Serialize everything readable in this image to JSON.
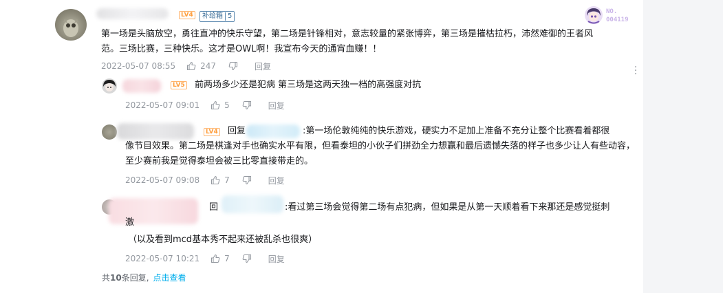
{
  "main_comment": {
    "level": "LV4",
    "fan_badge": {
      "name": "补给箱",
      "level": "5"
    },
    "text": "第一场是头脑放空，勇往直冲的快乐守望，第二场是针锋相对，意志较量的紧张博弈，第三场是摧枯拉朽，沛然难御的王者风范。三场比赛，三种快乐。这才是OWL啊！我宣布今天的通宵血赚！！",
    "time": "2022-05-07 08:55",
    "likes": "247",
    "reply_label": "回复",
    "badge_no_label": "NO.",
    "badge_no_value": "004119"
  },
  "replies": [
    {
      "level": "LV5",
      "text": "前两场多少还是犯病 第三场是这两天独一档的高强度对抗",
      "time": "2022-05-07 09:01",
      "likes": "5",
      "reply_label": "回复"
    },
    {
      "level": "LV4",
      "prefix": "回复",
      "text_line1": ":第一场伦敦纯纯的快乐游戏，硬实力不足加上准备不充分让整个比赛看着都很",
      "text_rest": "像节目效果。第二场是棋逢对手也确实水平有限，但看泰坦的小伙子们拼劲全力想赢和最后遗憾失落的样子也多少让人有些动容，至少赛前我是觉得泰坦会被三比零直接带走的。",
      "time": "2022-05-07 09:08",
      "likes": "7",
      "reply_label": "回复"
    },
    {
      "prefix": "回",
      "text_line1": ":看过第三场会觉得第二场有点犯病，但如果是从第一天顺着看下来那还是感觉挺刺",
      "text_line2": "激",
      "text_line3": "（以及看到mcd基本秀不起来还被乱杀也很爽）",
      "time": "2022-05-07 10:21",
      "likes": "7",
      "reply_label": "回复"
    }
  ],
  "footer": {
    "prefix": "共",
    "count": "10",
    "suffix": "条回复,",
    "link": "点击查看"
  }
}
